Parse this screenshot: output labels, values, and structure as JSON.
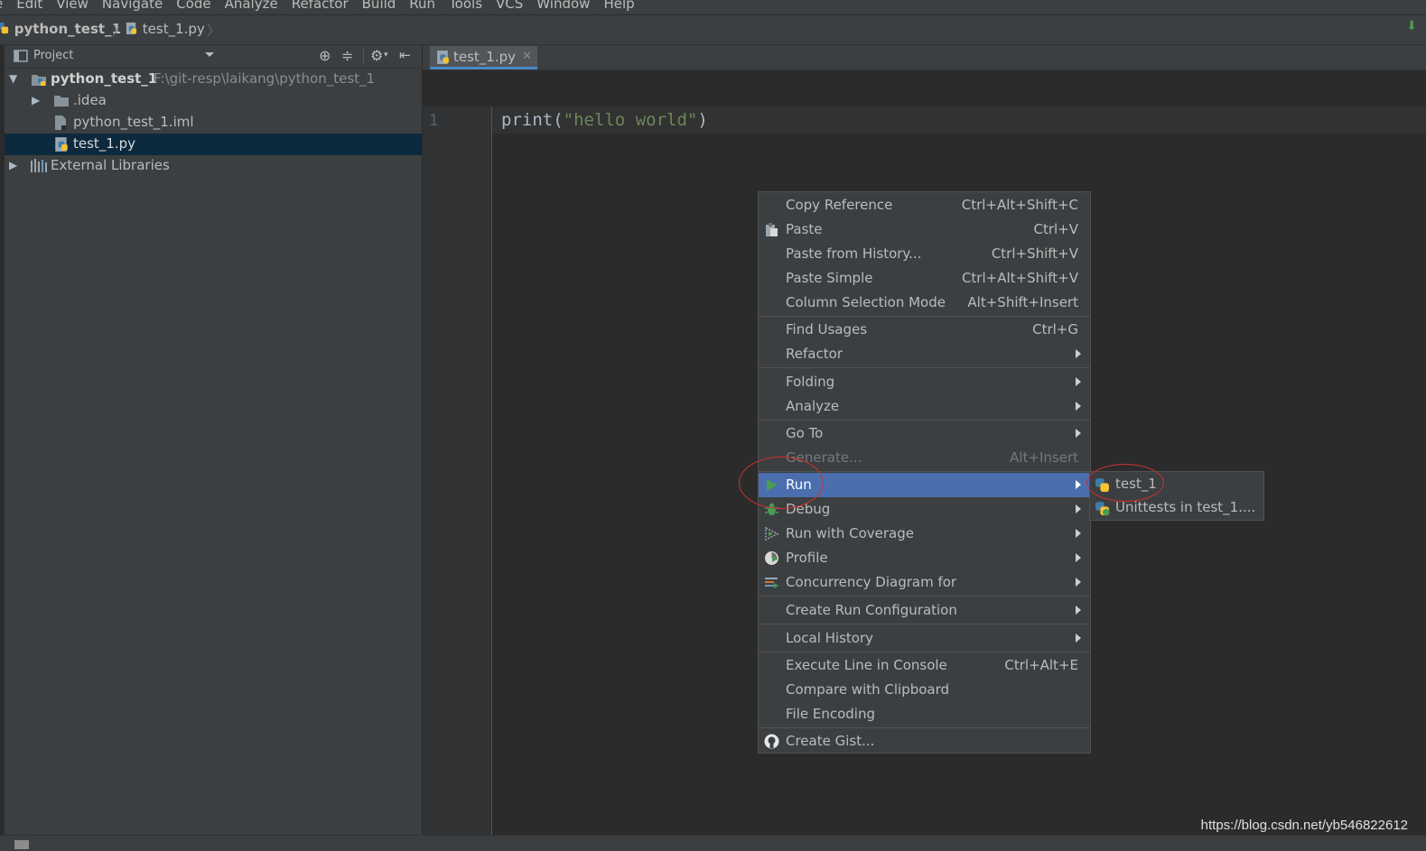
{
  "menubar": {
    "items": [
      "e",
      "Edit",
      "View",
      "Navigate",
      "Code",
      "Analyze",
      "Refactor",
      "Build",
      "Run",
      "Tools",
      "VCS",
      "Window",
      "Help"
    ]
  },
  "navbar": {
    "project": "python_test_1",
    "file": "test_1.py"
  },
  "project_panel": {
    "header": "Project",
    "root_name": "python_test_1",
    "root_path": "F:\\git-resp\\laikang\\python_test_1",
    "items": [
      {
        "label": ".idea"
      },
      {
        "label": "python_test_1.iml"
      },
      {
        "label": "test_1.py"
      },
      {
        "label": "External Libraries"
      }
    ]
  },
  "editor": {
    "tab": "test_1.py",
    "line_number": "1",
    "code_fn": "print",
    "code_open": "(",
    "code_str": "\"hello world\"",
    "code_close": ")"
  },
  "context_menu": {
    "items": [
      {
        "label": "Copy Reference",
        "shortcut": "Ctrl+Alt+Shift+C"
      },
      {
        "label": "Paste",
        "shortcut": "Ctrl+V",
        "icon": "clipboard-icon"
      },
      {
        "label": "Paste from History...",
        "shortcut": "Ctrl+Shift+V"
      },
      {
        "label": "Paste Simple",
        "shortcut": "Ctrl+Alt+Shift+V"
      },
      {
        "label": "Column Selection Mode",
        "shortcut": "Alt+Shift+Insert"
      },
      {
        "label": "Find Usages",
        "shortcut": "Ctrl+G"
      },
      {
        "label": "Refactor"
      },
      {
        "label": "Folding"
      },
      {
        "label": "Analyze"
      },
      {
        "label": "Go To"
      },
      {
        "label": "Generate...",
        "shortcut": "Alt+Insert",
        "disabled": true
      },
      {
        "label": "Run",
        "selected": true,
        "icon": "run-icon"
      },
      {
        "label": "Debug",
        "icon": "debug-icon"
      },
      {
        "label": "Run with Coverage",
        "icon": "coverage-icon"
      },
      {
        "label": "Profile",
        "icon": "profile-icon"
      },
      {
        "label": "Concurrency Diagram for",
        "icon": "concurrency-icon"
      },
      {
        "label": "Create Run Configuration"
      },
      {
        "label": "Local History"
      },
      {
        "label": "Execute Line in Console",
        "shortcut": "Ctrl+Alt+E"
      },
      {
        "label": "Compare with Clipboard"
      },
      {
        "label": "File Encoding"
      },
      {
        "label": "Create Gist...",
        "icon": "github-icon"
      }
    ]
  },
  "submenu": {
    "items": [
      {
        "label": "test_1"
      },
      {
        "label": "Unittests in test_1...."
      }
    ]
  },
  "watermark": "https://blog.csdn.net/yb546822612",
  "colors": {
    "selection": "#4b6eaf",
    "annotation": "#d0302f",
    "string": "#6a8759",
    "run_green": "#499c54"
  }
}
